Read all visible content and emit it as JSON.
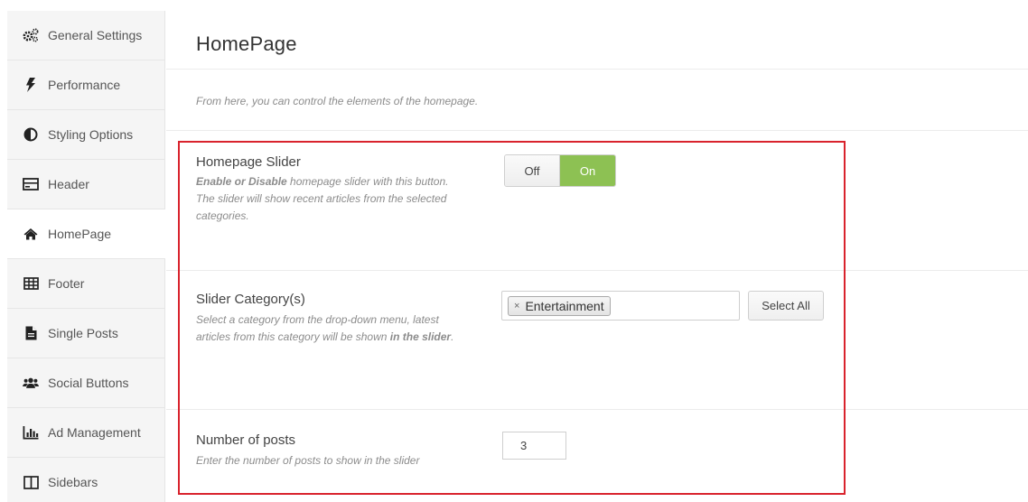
{
  "sidebar": {
    "items": [
      {
        "label": "General Settings",
        "icon": "gears-icon"
      },
      {
        "label": "Performance",
        "icon": "bolt-icon"
      },
      {
        "label": "Styling Options",
        "icon": "contrast-icon"
      },
      {
        "label": "Header",
        "icon": "header-icon"
      },
      {
        "label": "HomePage",
        "icon": "home-icon",
        "active": true
      },
      {
        "label": "Footer",
        "icon": "table-icon"
      },
      {
        "label": "Single Posts",
        "icon": "file-icon"
      },
      {
        "label": "Social Buttons",
        "icon": "users-icon"
      },
      {
        "label": "Ad Management",
        "icon": "bar-chart-icon"
      },
      {
        "label": "Sidebars",
        "icon": "columns-icon"
      }
    ]
  },
  "main": {
    "title": "HomePage",
    "intro": "From here, you can control the elements of the homepage.",
    "slider": {
      "title": "Homepage Slider",
      "desc_bold": "Enable or Disable",
      "desc_rest": " homepage slider with this button. The slider will show recent articles from the selected categories.",
      "off_label": "Off",
      "on_label": "On",
      "value": "On"
    },
    "category": {
      "title": "Slider Category(s)",
      "desc_start": "Select a category from the drop-down menu, latest articles from this category will be shown ",
      "desc_bold": "in the slider",
      "desc_end": ".",
      "selected_tag": "Entertainment",
      "remove_glyph": "×",
      "select_all_label": "Select All"
    },
    "posts": {
      "title": "Number of posts",
      "desc": "Enter the number of posts to show in the slider",
      "value": "3"
    }
  },
  "colors": {
    "highlight": "#d9232d",
    "toggle_on": "#8dc153"
  }
}
